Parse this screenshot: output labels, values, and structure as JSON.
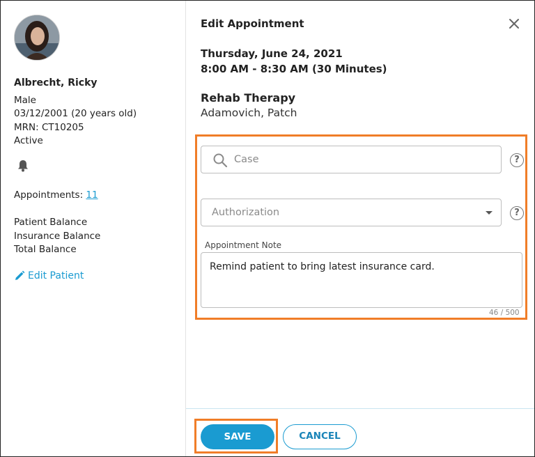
{
  "patient": {
    "name": "Albrecht, Ricky",
    "gender": "Male",
    "dob": "03/12/2001 (20 years old)",
    "mrn": "MRN: CT10205",
    "status": "Active",
    "appointments_label": "Appointments: ",
    "appointments_count": "11",
    "patient_balance_label": "Patient Balance",
    "insurance_balance_label": "Insurance Balance",
    "total_balance_label": "Total Balance",
    "edit_label": "Edit Patient"
  },
  "dialog": {
    "title": "Edit Appointment",
    "date": "Thursday, June 24, 2021",
    "time": "8:00 AM - 8:30 AM (30 Minutes)",
    "appointment_type": "Rehab Therapy",
    "provider": "Adamovich, Patch",
    "case_placeholder": "Case",
    "authorization_placeholder": "Authorization",
    "note_label": "Appointment Note",
    "note_value": "Remind patient to bring latest insurance card.",
    "note_counter": "46 / 500",
    "help_glyph": "?",
    "save_label": "SAVE",
    "cancel_label": "CANCEL"
  },
  "colors": {
    "accent": "#1a9bd1",
    "highlight": "#f07d28"
  },
  "icons": [
    "bell-icon",
    "pencil-icon",
    "search-icon",
    "close-icon",
    "help-icon",
    "chevron-down-icon"
  ]
}
